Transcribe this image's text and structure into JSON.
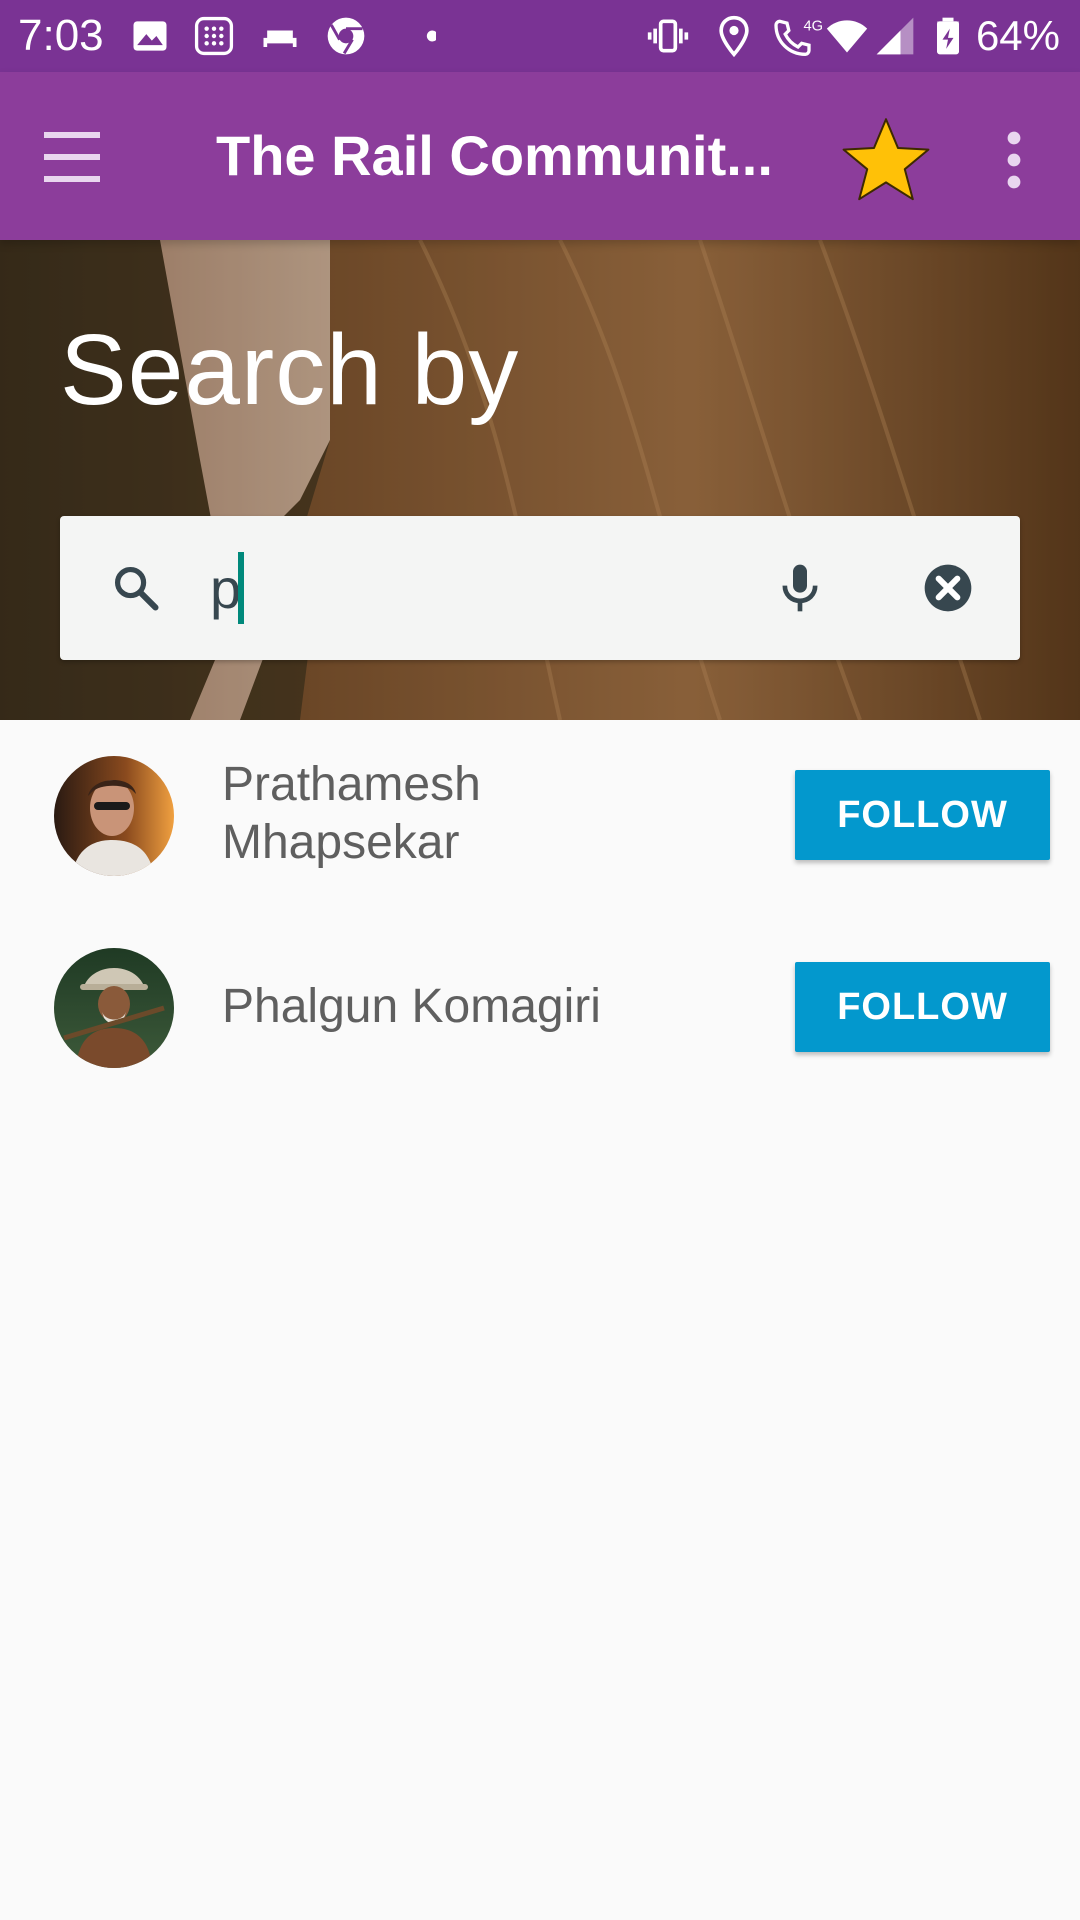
{
  "status_bar": {
    "time": "7:03",
    "battery_percent": "64%",
    "network_label": "4G",
    "icons": [
      "image-icon",
      "keypad-app-icon",
      "couch-icon",
      "chrome-icon",
      "dot-icon",
      "vibrate-icon",
      "location-icon",
      "wifi-calling-icon",
      "wifi-icon",
      "signal-icon",
      "battery-charging-icon"
    ],
    "background": "#7a3394"
  },
  "app_bar": {
    "title": "The Rail Communit...",
    "background": "#8c3d9b",
    "star_color": "#ffc107",
    "icons": [
      "menu-icon",
      "star-icon",
      "overflow-menu-icon"
    ]
  },
  "hero": {
    "title": "Search by"
  },
  "search": {
    "value": "p",
    "placeholder": "",
    "icons": [
      "search-icon",
      "microphone-icon",
      "clear-icon"
    ]
  },
  "results": [
    {
      "name_line1": "Prathamesh",
      "name_line2": "Mhapsekar",
      "button_label": "FOLLOW",
      "avatar": "avatar-man-sunglasses"
    },
    {
      "name_line1": "Phalgun Komagiri",
      "button_label": "FOLLOW",
      "avatar": "avatar-man-hat"
    }
  ],
  "colors": {
    "accent": "#0398cd",
    "text_secondary": "#5f5f5f"
  }
}
